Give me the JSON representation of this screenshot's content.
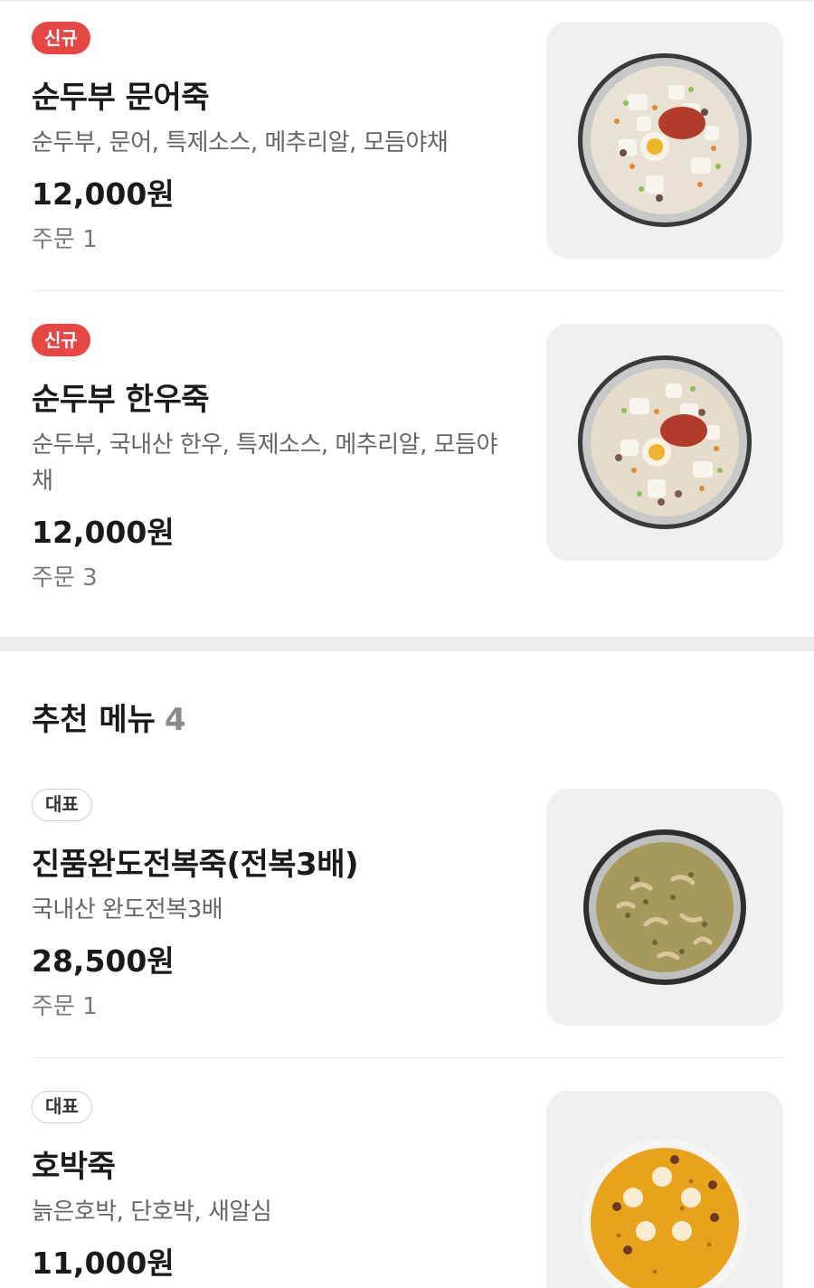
{
  "items_top": [
    {
      "badge": "신규",
      "name": "순두부 문어죽",
      "desc": "순두부, 문어, 특제소스, 메추리알, 모듬야채",
      "price": "12,000원",
      "orders": "주문 1",
      "image": "soft-tofu-octopus-porridge-bowl"
    },
    {
      "badge": "신규",
      "name": "순두부 한우죽",
      "desc": "순두부, 국내산 한우, 특제소스, 메추리알, 모듬야채",
      "price": "12,000원",
      "orders": "주문 3",
      "image": "soft-tofu-hanwoo-porridge-bowl"
    }
  ],
  "recommended": {
    "title": "추천 메뉴",
    "count": "4",
    "items": [
      {
        "badge": "대표",
        "name": "진품완도전복죽(전복3배)",
        "desc": "국내산 완도전복3배",
        "price": "28,500원",
        "orders": "주문 1",
        "image": "abalone-porridge-bowl"
      },
      {
        "badge": "대표",
        "name": "호박죽",
        "desc": "늙은호박, 단호박, 새알심",
        "price": "11,000원",
        "image": "pumpkin-porridge-bowl"
      }
    ]
  },
  "colors": {
    "badge_new": "#e84545",
    "badge_best_border": "#cfcfcf",
    "thumb_bg": "#efefef",
    "section_gap": "#eeeeee"
  }
}
